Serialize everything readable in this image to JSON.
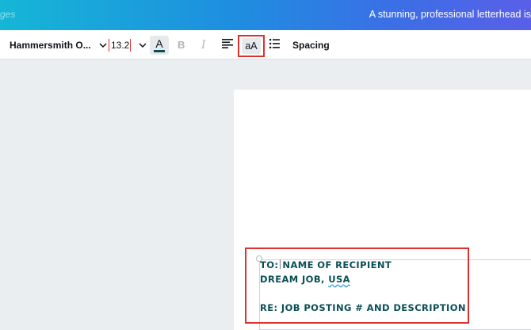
{
  "topbar": {
    "left_crumb": "ges",
    "doc_title": "A stunning, professional letterhead is"
  },
  "toolbar": {
    "font_family": "Hammersmith O...",
    "font_size": "13.2",
    "color_letter": "A",
    "text_color": "#0b4f56",
    "bold_label": "B",
    "italic_label": "I",
    "case_label": "aA",
    "spacing_label": "Spacing",
    "icons": [
      "chevron-down-icon",
      "align-left-icon",
      "list-icon"
    ]
  },
  "document": {
    "line1_prefix": "TO:",
    "line1_rest": "NAME OF RECIPIENT",
    "line2_part1": "DREAM JOB,",
    "line2_part2": "USA",
    "line3": "RE: JOB POSTING # AND DESCRIPTION"
  },
  "colors": {
    "highlight": "#e0302a",
    "accent_gradient_start": "#15b6d6",
    "accent_gradient_end": "#5a5fe8"
  }
}
